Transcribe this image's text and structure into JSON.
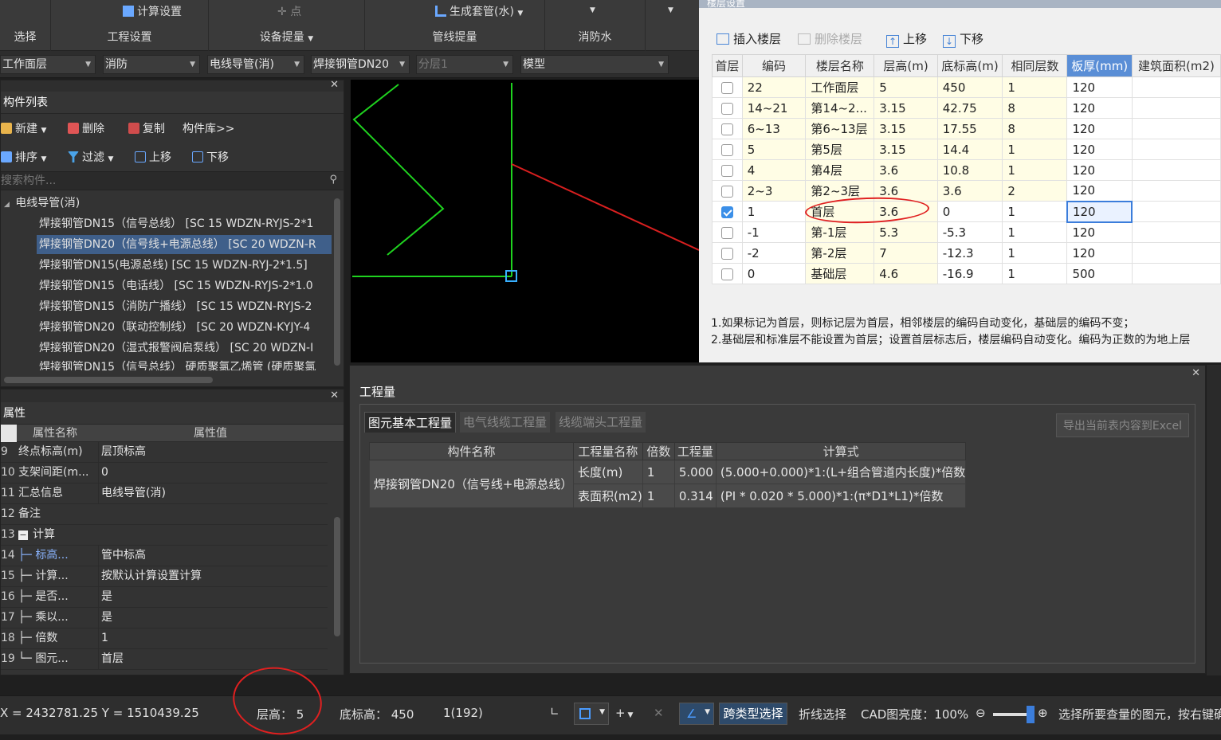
{
  "ribbon": {
    "groups": [
      {
        "label": "选择"
      },
      {
        "label": "工程设置",
        "small": "计算设置"
      },
      {
        "label": "设备提量",
        "small": "点"
      },
      {
        "label": "管线提量",
        "small": "生成套管(水)"
      },
      {
        "label": "消防水"
      }
    ]
  },
  "filters": [
    "工作面层",
    "消防",
    "电线导管(消)",
    "焊接钢管DN20",
    "分层1",
    "模型"
  ],
  "components": {
    "title": "构件列表",
    "tools1": [
      "新建",
      "删除",
      "复制",
      "构件库>>"
    ],
    "tools2": [
      "排序",
      "过滤",
      "上移",
      "下移"
    ],
    "search_placeholder": "搜索构件...",
    "root": "电线导管(消)",
    "items": [
      "焊接钢管DN15（信号总线） [SC 15 WDZN-RYJS-2*1",
      "焊接钢管DN20（信号线+电源总线） [SC 20 WDZN-R",
      "焊接钢管DN15(电源总线) [SC 15 WDZN-RYJ-2*1.5]",
      "焊接钢管DN15（电话线） [SC 15 WDZN-RYJS-2*1.0",
      "焊接钢管DN15（消防广播线） [SC 15 WDZN-RYJS-2",
      "焊接钢管DN20（联动控制线） [SC 20 WDZN-KYJY-4",
      "焊接钢管DN20（湿式报警阀启泵线） [SC 20 WDZN-I",
      "焊接钢管DN15（信号总线） 硬质聚氯乙烯管 (硬质聚氯"
    ]
  },
  "properties": {
    "title": "属性",
    "col_name": "属性名称",
    "col_value": "属性值",
    "rows": [
      {
        "n": "9",
        "k": "终点标高(m)",
        "v": "层顶标高"
      },
      {
        "n": "10",
        "k": "支架间距(m...",
        "v": "0"
      },
      {
        "n": "11",
        "k": "汇总信息",
        "v": "电线导管(消)"
      },
      {
        "n": "12",
        "k": "备注",
        "v": ""
      },
      {
        "n": "13",
        "k": "计算",
        "v": ""
      },
      {
        "n": "14",
        "k": "标高...",
        "v": "管中标高"
      },
      {
        "n": "15",
        "k": "计算...",
        "v": "按默认计算设置计算"
      },
      {
        "n": "16",
        "k": "是否...",
        "v": "是"
      },
      {
        "n": "17",
        "k": "乘以...",
        "v": "是"
      },
      {
        "n": "18",
        "k": "倍数",
        "v": "1"
      },
      {
        "n": "19",
        "k": "图元...",
        "v": "首层"
      }
    ]
  },
  "floor_dialog": {
    "title": "楼层设置",
    "tools": [
      "插入楼层",
      "删除楼层",
      "上移",
      "下移"
    ],
    "headers": [
      "首层",
      "编码",
      "楼层名称",
      "层高(m)",
      "底标高(m)",
      "相同层数",
      "板厚(mm)",
      "建筑面积(m2)"
    ],
    "rows": [
      {
        "first": false,
        "code": "22",
        "name": "工作面层",
        "h": "5",
        "base": "450",
        "same": "1",
        "slab": "120"
      },
      {
        "first": false,
        "code": "14~21",
        "name": "第14~2...",
        "h": "3.15",
        "base": "42.75",
        "same": "8",
        "slab": "120"
      },
      {
        "first": false,
        "code": "6~13",
        "name": "第6~13层",
        "h": "3.15",
        "base": "17.55",
        "same": "8",
        "slab": "120"
      },
      {
        "first": false,
        "code": "5",
        "name": "第5层",
        "h": "3.15",
        "base": "14.4",
        "same": "1",
        "slab": "120"
      },
      {
        "first": false,
        "code": "4",
        "name": "第4层",
        "h": "3.6",
        "base": "10.8",
        "same": "1",
        "slab": "120"
      },
      {
        "first": false,
        "code": "2~3",
        "name": "第2~3层",
        "h": "3.6",
        "base": "3.6",
        "same": "2",
        "slab": "120"
      },
      {
        "first": true,
        "code": "1",
        "name": "首层",
        "h": "3.6",
        "base": "0",
        "same": "1",
        "slab": "120"
      },
      {
        "first": false,
        "code": "-1",
        "name": "第-1层",
        "h": "5.3",
        "base": "-5.3",
        "same": "1",
        "slab": "120"
      },
      {
        "first": false,
        "code": "-2",
        "name": "第-2层",
        "h": "7",
        "base": "-12.3",
        "same": "1",
        "slab": "120"
      },
      {
        "first": false,
        "code": "0",
        "name": "基础层",
        "h": "4.6",
        "base": "-16.9",
        "same": "1",
        "slab": "500"
      }
    ],
    "note1": "1.如果标记为首层，则标记层为首层，相邻楼层的编码自动变化，基础层的编码不变；",
    "note2": "2.基础层和标准层不能设置为首层；设置首层标志后，楼层编码自动变化。编码为正数的为地上层"
  },
  "quantity": {
    "title": "工程量",
    "tabs": [
      "图元基本工程量",
      "电气线缆工程量",
      "线缆端头工程量"
    ],
    "export": "导出当前表内容到Excel",
    "headers": [
      "构件名称",
      "工程量名称",
      "倍数",
      "工程量",
      "计算式"
    ],
    "component": "焊接钢管DN20（信号线+电源总线）",
    "rows": [
      {
        "qname": "长度(m)",
        "mult": "1",
        "qty": "5.000",
        "formula": "(5.000+0.000)*1:(L+组合管道内长度)*倍数"
      },
      {
        "qname": "表面积(m2)",
        "mult": "1",
        "qty": "0.314",
        "formula": "(PI * 0.020 * 5.000)*1:(π*D1*L1)*倍数"
      }
    ]
  },
  "status": {
    "coords": "X = 2432781.25 Y = 1510439.25",
    "floor_height": "层高： 5",
    "base_height": "底标高： 450",
    "count": "1(192)",
    "cross_select": "跨类型选择",
    "poly_select": "折线选择",
    "cad_brightness": "CAD图亮度：100%",
    "hint": "选择所要查量的图元，按右键确"
  }
}
